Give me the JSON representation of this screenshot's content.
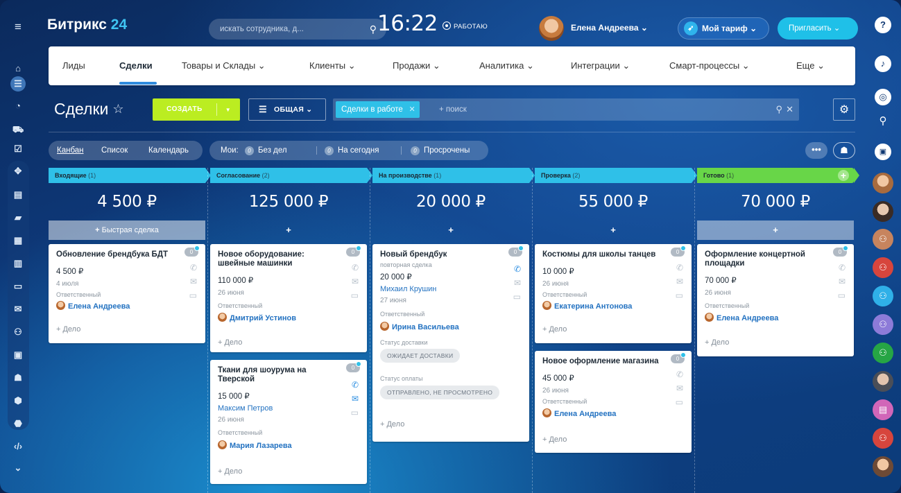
{
  "brand": {
    "name": "Битрикс",
    "num": "24"
  },
  "header": {
    "search_placeholder": "искать сотрудника, д...",
    "clock": "16:22",
    "work_status": "РАБОТАЮ",
    "user_name": "Елена Андреева",
    "tariff": "Мой тариф",
    "invite": "Пригласить"
  },
  "nav": [
    "Лиды",
    "Сделки",
    "Товары и Склады",
    "Клиенты",
    "Продажи",
    "Аналитика",
    "Интеграции",
    "Смарт-процессы",
    "Еще"
  ],
  "toolbar": {
    "title": "Сделки",
    "create": "СОЗДАТЬ",
    "filter_preset": "ОБЩАЯ",
    "chip": "Сделки в работе",
    "search_placeholder": "+ поиск"
  },
  "views": {
    "kanban": "Канбан",
    "list": "Список",
    "calendar": "Календарь"
  },
  "counters": {
    "label": "Мои:",
    "items": [
      {
        "count": "0",
        "label": "Без дел"
      },
      {
        "count": "0",
        "label": "На сегодня"
      },
      {
        "count": "0",
        "label": "Просрочены"
      }
    ]
  },
  "stages": [
    {
      "name": "Входящие",
      "count": "(1)",
      "color": "#2fc0e8",
      "sum": "4 500 ₽",
      "add": "Быстрая сделка"
    },
    {
      "name": "Согласование",
      "count": "(2)",
      "color": "#2fc0e8",
      "sum": "125 000 ₽",
      "add": "+"
    },
    {
      "name": "На производстве",
      "count": "(1)",
      "color": "#2fc0e8",
      "sum": "20 000 ₽",
      "add": "+"
    },
    {
      "name": "Проверка",
      "count": "(2)",
      "color": "#2fc0e8",
      "sum": "55 000 ₽",
      "add": "+"
    },
    {
      "name": "Готово",
      "count": "(1)",
      "color": "#68d648",
      "sum": "70 000 ₽",
      "add": "+"
    }
  ],
  "labels": {
    "responsible": "Ответственный",
    "add_task": "+ Дело",
    "delivery_status": "Статус доставки",
    "payment_status": "Статус оплаты"
  },
  "cards": {
    "c1": {
      "title": "Обновление брендбука БДТ",
      "amount": "4 500 ₽",
      "date": "4 июля",
      "person": "Елена Андреева",
      "badge": "0"
    },
    "c2": {
      "title": "Новое оборудование: швейные машинки",
      "amount": "110 000 ₽",
      "date": "26 июня",
      "person": "Дмитрий Устинов",
      "badge": "0"
    },
    "c3": {
      "title": "Ткани для шоурума на Тверской",
      "amount": "15 000 ₽",
      "contact": "Максим Петров",
      "date": "26 июня",
      "person": "Мария Лазарева",
      "badge": "0"
    },
    "c4": {
      "title": "Новый брендбук",
      "sub": "повторная сделка",
      "amount": "20 000 ₽",
      "contact": "Михаил Крушин",
      "date": "27 июня",
      "person": "Ирина Васильева",
      "delivery": "ОЖИДАЕТ ДОСТАВКИ",
      "payment": "ОТПРАВЛЕНО, НЕ ПРОСМОТРЕНО",
      "badge": "0"
    },
    "c5": {
      "title": "Костюмы для школы танцев",
      "amount": "10 000 ₽",
      "date": "26 июня",
      "person": "Екатерина Антонова",
      "badge": "0"
    },
    "c6": {
      "title": "Новое оформление магазина",
      "amount": "45 000 ₽",
      "date": "26 июня",
      "person": "Елена Андреева",
      "badge": "0"
    },
    "c7": {
      "title": "Оформление концертной площадки",
      "amount": "70 000 ₽",
      "date": "26 июня",
      "person": "Елена Андреева",
      "badge": "0"
    }
  }
}
